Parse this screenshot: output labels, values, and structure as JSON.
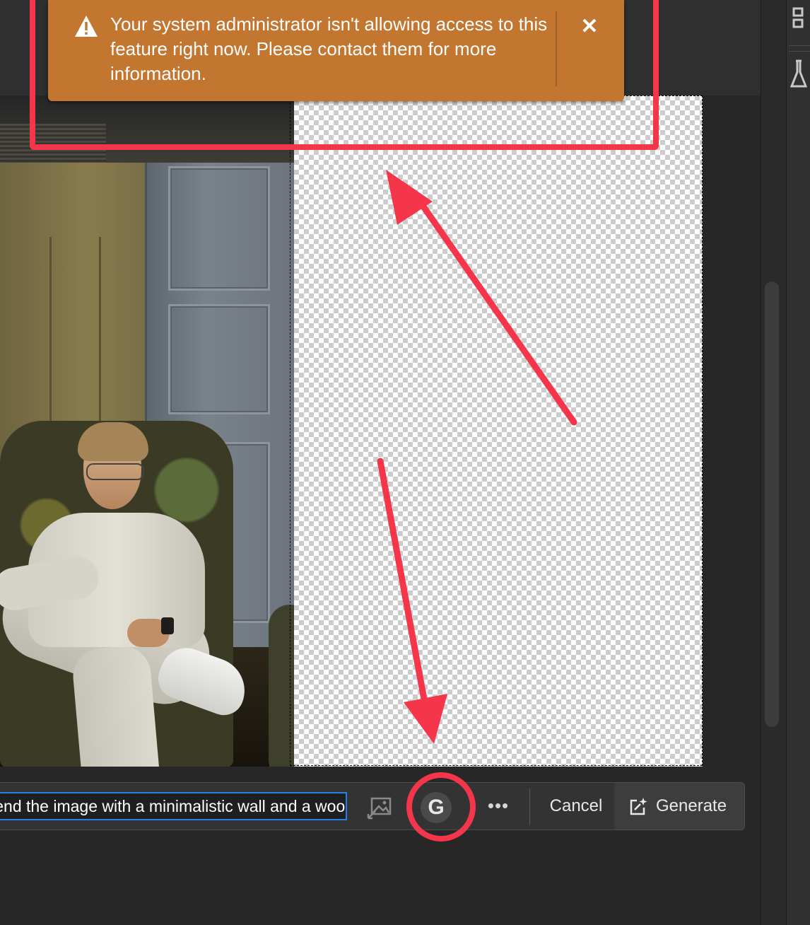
{
  "alert": {
    "message": "Your system administrator isn't allowing access to this feature right now. Please contact them for more information.",
    "close_symbol": "✕",
    "icon": "warning-icon",
    "background": "#c27630"
  },
  "taskbar": {
    "prompt_value": "Extend the image with a minimalistic wall and a wooden floor",
    "reference_icon": "reference-image-icon",
    "g_label": "G",
    "more_label": "•••",
    "cancel_label": "Cancel",
    "generate_label": "Generate",
    "generate_icon": "generate-sparkle-icon",
    "focus_color": "#2680eb"
  },
  "annotations": {
    "color": "#f5354a"
  }
}
